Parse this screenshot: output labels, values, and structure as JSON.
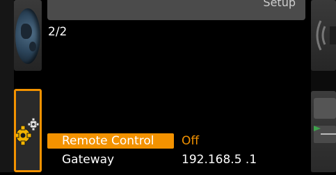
{
  "header": {
    "title": "Setup"
  },
  "page_indicator": "2/2",
  "menu": {
    "rows": [
      {
        "label": "Remote Control",
        "value": "Off",
        "selected": true
      },
      {
        "label": "Gateway",
        "value": "192.168.5  .1",
        "selected": false
      }
    ]
  },
  "side_icons": {
    "left_top": "globe-icon",
    "left_active": "gears-icon",
    "right_top": "speaker-icon",
    "right_bottom": "gauge-icon"
  },
  "colors": {
    "accent": "#f39200",
    "background": "#000000",
    "header": "#4b4b4b"
  }
}
